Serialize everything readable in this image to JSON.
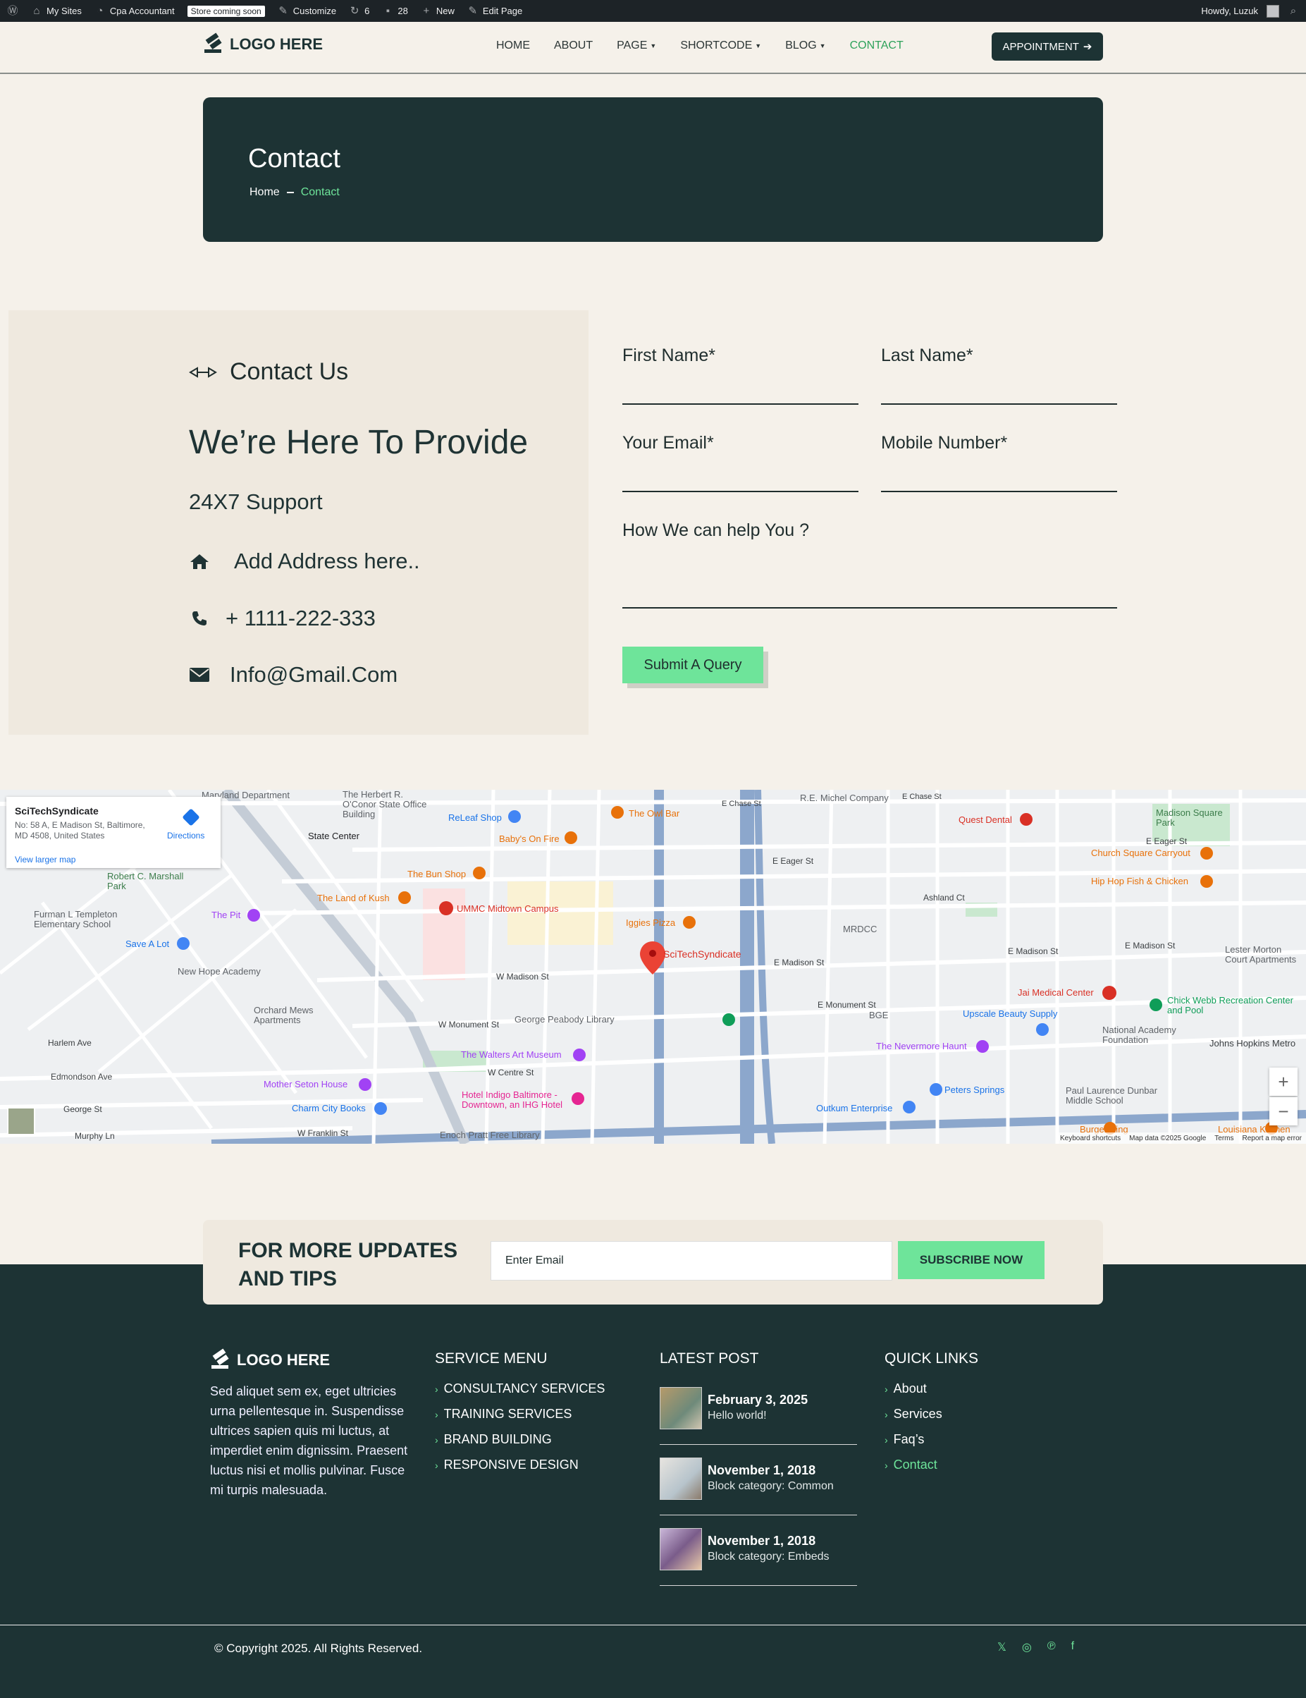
{
  "adminbar": {
    "my_sites": "My Sites",
    "site_name": "Cpa Accountant",
    "store_badge": "Store coming soon",
    "customize": "Customize",
    "updates": "6",
    "comments": "28",
    "new": "New",
    "edit_page": "Edit Page",
    "howdy": "Howdy, Luzuk"
  },
  "header": {
    "logo": "LOGO HERE",
    "nav": [
      {
        "label": "HOME",
        "caret": false
      },
      {
        "label": "ABOUT",
        "caret": false
      },
      {
        "label": "PAGE",
        "caret": true
      },
      {
        "label": "SHORTCODE",
        "caret": true
      },
      {
        "label": "BLOG",
        "caret": true
      },
      {
        "label": "CONTACT",
        "caret": false,
        "active": true
      }
    ],
    "appointment": "APPOINTMENT"
  },
  "banner": {
    "title": "Contact",
    "breadcrumb_home": "Home",
    "breadcrumb_current": "Contact"
  },
  "contact_info": {
    "heading": "Contact Us",
    "title": "We’re Here To Provide",
    "subtitle": "24X7 Support",
    "address": "Add Address here..",
    "phone": "+ 1111-222-333",
    "email": "Info@Gmail.Com"
  },
  "form": {
    "first_name": "First Name*",
    "last_name": "Last Name*",
    "email": "Your Email*",
    "mobile": "Mobile Number*",
    "message": "How We can help You ?",
    "submit": "Submit A Query"
  },
  "map": {
    "place_name": "SciTechSyndicate",
    "place_address": "No: 58 A, E Madison St, Baltimore, MD 4508, United States",
    "directions": "Directions",
    "larger_map": "View larger map",
    "pin_label": "SciTechSyndicate",
    "footer": [
      "Keyboard shortcuts",
      "Map data ©2025 Google",
      "Terms",
      "Report a map error"
    ],
    "labels": [
      "Maryland Department",
      "The Herbert R. O'Conor State Office Building",
      "ReLeaf Shop",
      "The Owl Bar",
      "E Chase St",
      "R.E. Michel Company",
      "E Chase St",
      "Madison Square Park",
      "Quest Dental",
      "State Center",
      "Baby's On Fire",
      "E Eager St",
      "E Eager St",
      "Church Square Carryout",
      "Robert C. Marshall Park",
      "The Bun Shop",
      "Hip Hop Fish & Chicken",
      "The Land of Kush",
      "UMMC Midtown Campus",
      "Ashland Ct",
      "Furman L Templeton Elementary School",
      "The Pit",
      "Iggies Pizza",
      "MRDCC",
      "E Madison St",
      "E Madison St",
      "Lester Morton Court Apartments",
      "Save A Lot",
      "E Madison St",
      "W Madison St",
      "New Hope Academy",
      "Jai Medical Center",
      "Chick Webb Recreation Center and Pool",
      "E Monument St",
      "BGE",
      "Upscale Beauty Supply",
      "Orchard Mews Apartments",
      "W Monument St",
      "George Peabody Library",
      "National Academy Foundation",
      "Johns Hopkins Metro",
      "Harlem Ave",
      "The Walters Art Museum",
      "The Nevermore Haunt",
      "W Centre St",
      "Edmondson Ave",
      "Mother Seton House",
      "Peters Springs",
      "Paul Laurence Dunbar Middle School",
      "George St",
      "Charm City Books",
      "Hotel Indigo Baltimore - Downtown, an IHG Hotel",
      "Outkum Enterprise",
      "Murphy Ln",
      "W Franklin St",
      "Enoch Pratt Free Library",
      "Burger King",
      "Louisiana Kitchen"
    ]
  },
  "newsletter": {
    "title": "FOR MORE UPDATES AND TIPS",
    "placeholder": "Enter Email",
    "button": "SUBSCRIBE NOW"
  },
  "footer": {
    "logo": "LOGO HERE",
    "about": "Sed aliquet sem ex, eget ultricies urna pellentesque in. Suspendisse ultrices sapien quis mi luctus, at imperdiet enim dignissim. Praesent luctus nisi et mollis pulvinar. Fusce mi turpis malesuada.",
    "service_title": "SERVICE MENU",
    "services": [
      "CONSULTANCY SERVICES",
      "TRAINING SERVICES",
      "BRAND BUILDING",
      "RESPONSIVE DESIGN"
    ],
    "posts_title": "LATEST POST",
    "posts": [
      {
        "date": "February 3, 2025",
        "title": "Hello world!"
      },
      {
        "date": "November 1, 2018",
        "title": "Block category: Common"
      },
      {
        "date": "November 1, 2018",
        "title": "Block category: Embeds"
      }
    ],
    "links_title": "QUICK LINKS",
    "links": [
      {
        "label": "About"
      },
      {
        "label": "Services"
      },
      {
        "label": "Faq’s"
      },
      {
        "label": "Contact",
        "active": true
      }
    ],
    "copyright": "© Copyright 2025. All Rights Reserved.",
    "social": [
      "x-icon",
      "instagram-icon",
      "pinterest-icon",
      "facebook-icon"
    ]
  },
  "colors": {
    "dark": "#1d3334",
    "accent": "#6ee49a",
    "page_bg": "#f5f1ea",
    "panel_bg": "#efe9df"
  }
}
